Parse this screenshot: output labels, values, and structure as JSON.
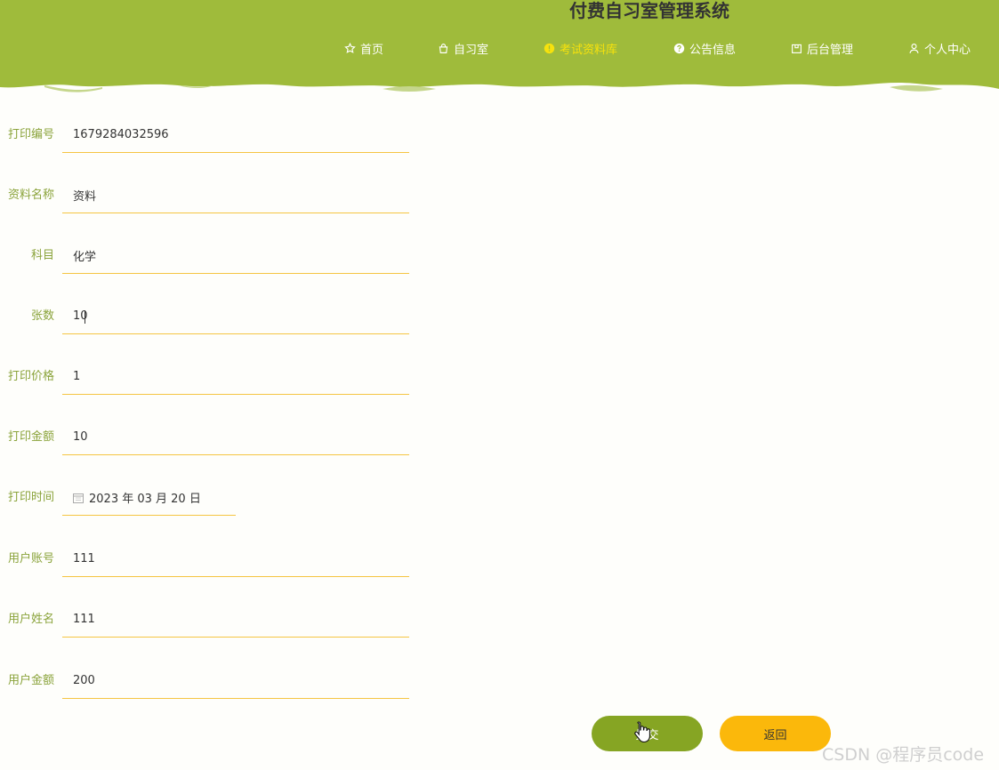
{
  "header": {
    "site_title": "付费自习室管理系统",
    "nav": [
      {
        "label": "首页",
        "icon": "star-icon"
      },
      {
        "label": "自习室",
        "icon": "bag-icon"
      },
      {
        "label": "考试资料库",
        "icon": "info-icon",
        "active": true
      },
      {
        "label": "公告信息",
        "icon": "question-icon"
      },
      {
        "label": "后台管理",
        "icon": "box-icon"
      },
      {
        "label": "个人中心",
        "icon": "user-icon"
      }
    ]
  },
  "form": {
    "print_no": {
      "label": "打印编号",
      "value": "1679284032596"
    },
    "material_name": {
      "label": "资料名称",
      "value": "资料"
    },
    "subject": {
      "label": "科目",
      "value": "化学"
    },
    "sheets": {
      "label": "张数",
      "value": "10"
    },
    "print_price": {
      "label": "打印价格",
      "value": "1"
    },
    "print_amount": {
      "label": "打印金额",
      "value": "10"
    },
    "print_time": {
      "label": "打印时间",
      "value": "2023 年 03 月 20 日"
    },
    "user_account": {
      "label": "用户账号",
      "value": "111"
    },
    "user_name": {
      "label": "用户姓名",
      "value": "111"
    },
    "user_balance": {
      "label": "用户金额",
      "value": "200"
    }
  },
  "buttons": {
    "submit": "提交",
    "back": "返回"
  },
  "watermark": "CSDN @程序员code",
  "colors": {
    "header_green": "#9fbb3b",
    "nav_active": "#f7e20c",
    "label_green": "#8aa33a",
    "underline": "#f5c542",
    "submit_bg": "#86a523",
    "back_bg": "#fbb80b"
  }
}
